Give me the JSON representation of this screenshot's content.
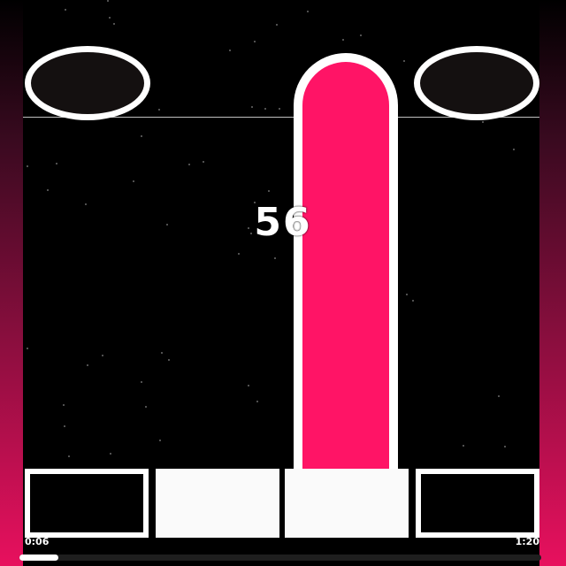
{
  "game": {
    "combo": "56",
    "colors": {
      "note": "#ff1466",
      "background": "#000000",
      "glow": "#e8105e"
    },
    "lanes": [
      {
        "lane": 1,
        "pressed": false
      },
      {
        "lane": 2,
        "pressed": true
      },
      {
        "lane": 3,
        "pressed": true
      },
      {
        "lane": 4,
        "pressed": false
      }
    ]
  },
  "playback": {
    "elapsed": "0:06",
    "total": "1:20",
    "progress": 0.075
  }
}
